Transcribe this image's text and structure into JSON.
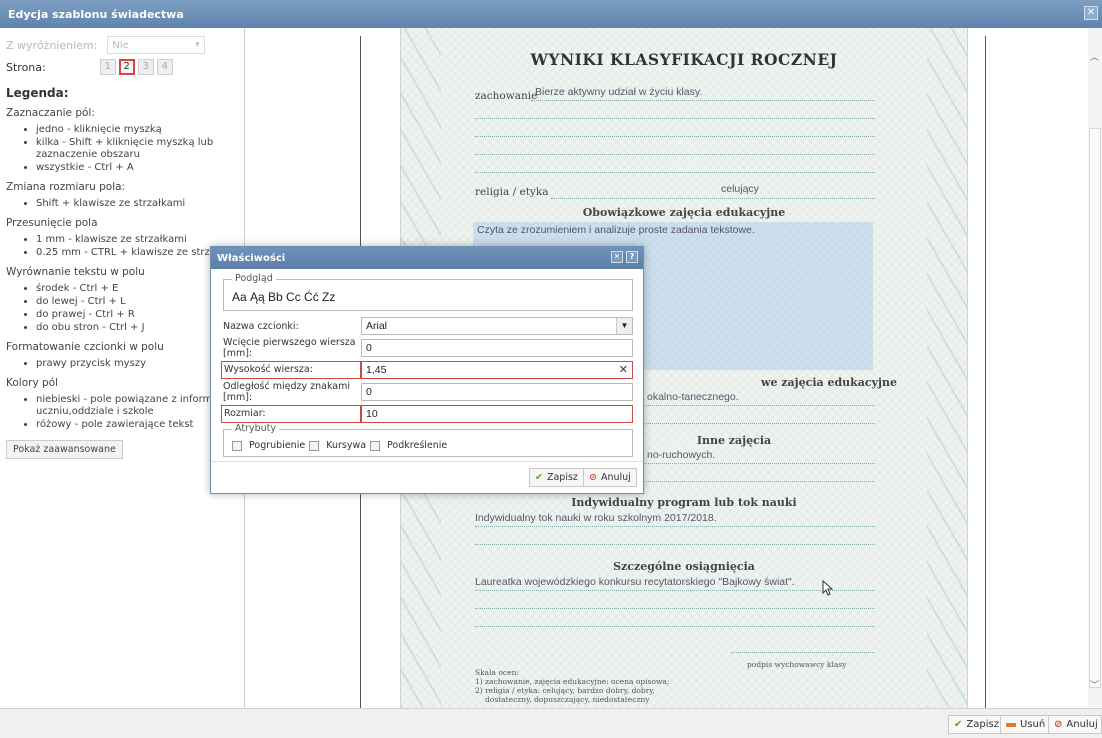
{
  "window": {
    "title": "Edycja szablonu świadectwa",
    "close_icon": "close-icon"
  },
  "left": {
    "wyr_label": "Z wyróżnieniem:",
    "wyr_value": "Nie",
    "strona_label": "Strona:",
    "pages": [
      "1",
      "2",
      "3",
      "4"
    ],
    "active_page": "2",
    "legend_title": "Legenda:",
    "sections": [
      {
        "title": "Zaznaczanie pól:",
        "items": [
          "jedno - kliknięcie myszką",
          "kilka - Shift + kliknięcie myszką lub zaznaczenie obszaru",
          "wszystkie - Ctrl + A"
        ]
      },
      {
        "title": "Zmiana rozmiaru pola:",
        "items": [
          "Shift + klawisze ze strzałkami"
        ]
      },
      {
        "title": "Przesunięcie pola",
        "items": [
          "1 mm - klawisze ze strzałkami",
          "0.25 mm - CTRL + klawisze ze strzałkami"
        ]
      },
      {
        "title": "Wyrównanie tekstu w polu",
        "items": [
          "środek - Ctrl + E",
          "do lewej - Ctrl + L",
          "do prawej - Ctrl + R",
          "do obu stron - Ctrl + J"
        ]
      },
      {
        "title": "Formatowanie czcionki w polu",
        "items": [
          "prawy przycisk myszy"
        ]
      },
      {
        "title": "Kolory pól",
        "items": [
          "niebieski - pole powiązane z informacją o uczniu,oddziale i szkole",
          "różowy - pole zawierające tekst"
        ]
      }
    ],
    "advanced_button": "Pokaż zaawansowane"
  },
  "document": {
    "title": "WYNIKI KLASYFIKACJI ROCZNEJ",
    "zachowanie_label": "zachowanie",
    "zachowanie_value": "Bierze aktywny udział w życiu klasy.",
    "religia_label": "religia / etyka",
    "religia_value": "celujący",
    "obowiazkowe_title": "Obowiązkowe zajęcia edukacyjne",
    "obowiazkowe_value": "Czyta ze zrozumieniem i analizuje proste zadania tekstowe.",
    "dodatkowe_title_partial": "we zajęcia edukacyjne",
    "dodatkowe_value_partial": "okalno-tanecznego.",
    "inne_title_partial": "Inne zajęcia",
    "inne_value_partial": "no-ruchowych.",
    "indywidualny_title": "Indywidualny program lub tok nauki",
    "indywidualny_value": "Indywidualny tok nauki w roku szkolnym 2017/2018.",
    "osiagniecia_title": "Szczególne osiągnięcia",
    "osiagniecia_value": "Laureatka wojewódzkiego konkursu recytatorskiego \"Bajkowy świat\".",
    "skala_label": "Skala ocen:",
    "skala_1": "1) zachowanie, zajęcia edukacyjne: ocena opisowa;",
    "skala_2": "2) religia / etyka: celujący, bardzo dobry, dobry,",
    "skala_3": "dostateczny, dopuszczający, niedostateczny",
    "podpis": "podpis wychowawcy klasy"
  },
  "dialog": {
    "title": "Właściwości",
    "preview_legend": "Podgląd",
    "preview_text": "Aa Ąą Bb Cc Ćć Zz",
    "fields": {
      "font_label": "Nazwa czcionki:",
      "font_value": "Arial",
      "indent_label": "Wcięcie pierwszego wiersza [mm]:",
      "indent_value": "0",
      "line_height_label": "Wysokość wiersza:",
      "line_height_value": "1,45",
      "spacing_label": "Odległość między znakami [mm]:",
      "spacing_value": "0",
      "size_label": "Rozmiar:",
      "size_value": "10"
    },
    "attributes_legend": "Atrybuty",
    "bold_label": "Pogrubienie",
    "italic_label": "Kursywa",
    "underline_label": "Podkreślenie",
    "save_label": "Zapisz",
    "cancel_label": "Anuluj"
  },
  "footer": {
    "save_label": "Zapisz",
    "delete_label": "Usuń",
    "cancel_label": "Anuluj"
  },
  "colors": {
    "titlebar": "#6f93bb",
    "red_outline": "#d04545",
    "green_check": "#5aa02c",
    "cancel_red": "#d84a3a"
  }
}
